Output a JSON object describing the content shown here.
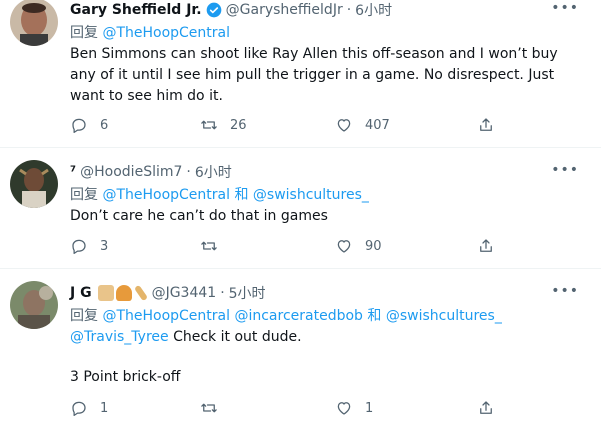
{
  "tweets": [
    {
      "name": "Gary Sheffield Jr.",
      "handle": "@GarysheffieldJr",
      "dot": "·",
      "time": "6小时",
      "reply_prefix": "回复",
      "reply_to": [
        "@TheHoopCentral"
      ],
      "reply_joiner": "",
      "text": "Ben Simmons can shoot like Ray Allen this off-season and I won’t buy any of it until I see him pull the trigger in a game. No disrespect. Just want to see him do it.",
      "replies": "6",
      "retweets": "26",
      "likes": "407",
      "more": "•••"
    },
    {
      "name": "⁷",
      "handle": "@HoodieSlim7",
      "dot": "·",
      "time": "6小时",
      "reply_prefix": "回复",
      "reply_to": [
        "@TheHoopCentral",
        "@swishcultures_"
      ],
      "reply_joiner": "和",
      "text": "Don’t care he can’t do that in games",
      "replies": "3",
      "retweets": "",
      "likes": "90",
      "more": "•••"
    },
    {
      "name": "J G",
      "handle": "@JG3441",
      "dot": "·",
      "time": "5小时",
      "reply_prefix": "回复",
      "reply_to": [
        "@TheHoopCentral",
        "@incarceratedbob",
        "@swishcultures_",
        "@Travis_Tyree"
      ],
      "reply_joiner": "和",
      "text_line1": "Check it out dude.",
      "text_line2": "3 Point brick-off",
      "replies": "1",
      "retweets": "",
      "likes": "1",
      "more": "•••"
    }
  ],
  "colors": {
    "link": "#1d9bf0",
    "muted": "#536471",
    "verified": "#1d9bf0"
  },
  "icons": [
    "reply-icon",
    "retweet-icon",
    "like-icon",
    "share-icon",
    "verified-badge-icon",
    "more-icon"
  ]
}
